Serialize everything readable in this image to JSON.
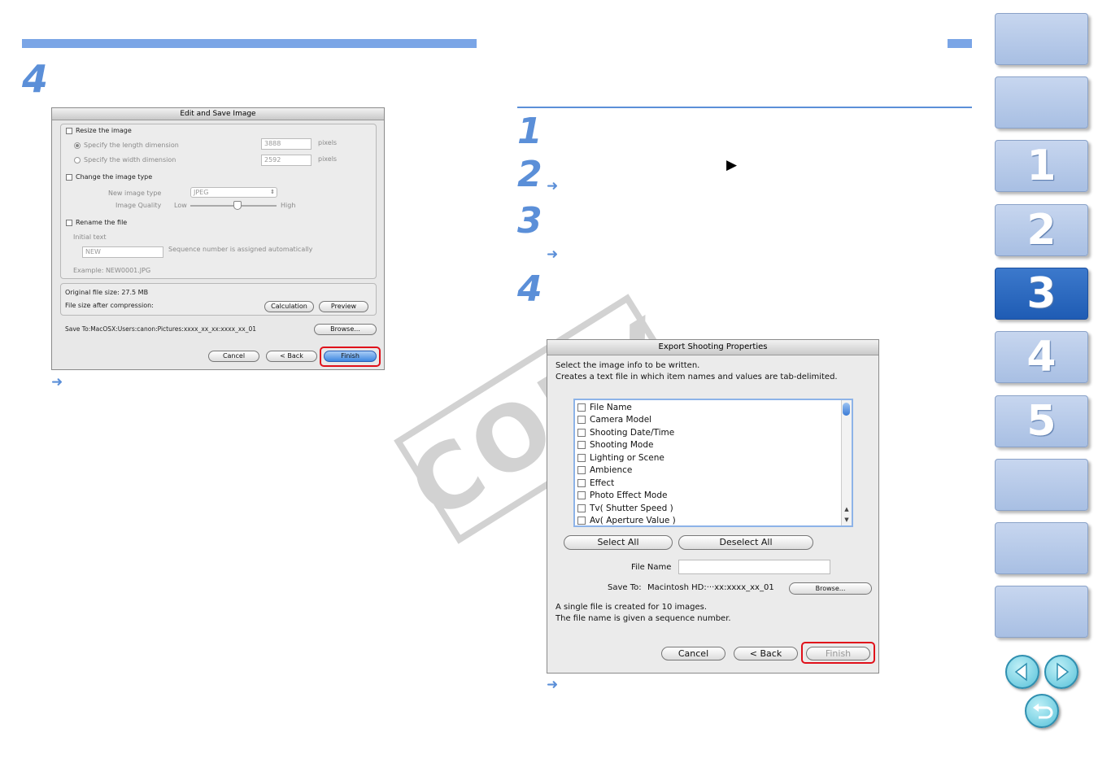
{
  "page": {
    "left_step": "4",
    "right_steps": [
      "1",
      "2",
      "3",
      "4"
    ],
    "arrow_symbol": "➜",
    "play_symbol": "▶"
  },
  "edit_dialog": {
    "title": "Edit and Save Image",
    "resize_label": "Resize the image",
    "length_option": "Specify the length dimension",
    "width_option": "Specify the width dimension",
    "length_value": "3888",
    "width_value": "2592",
    "pixels_unit": "pixels",
    "change_type_label": "Change the image type",
    "new_type_label": "New image type",
    "new_type_value": "JPEG",
    "quality_label": "Image Quality",
    "quality_low": "Low",
    "quality_high": "High",
    "quality_level": 0.55,
    "rename_label": "Rename the file",
    "initial_text_label": "Initial text",
    "initial_text_value": "NEW",
    "sequence_note": "Sequence number is assigned automatically",
    "example_text": "Example:  NEW0001.JPG",
    "original_size_label": "Original file size:",
    "original_size_value": "27.5 MB",
    "compressed_size_label": "File size after compression:",
    "calculation_button": "Calculation",
    "preview_button": "Preview",
    "save_to": "Save To:MacOSX:Users:canon:Pictures:xxxx_xx_xx:xxxx_xx_01",
    "browse_button": "Browse...",
    "cancel_button": "Cancel",
    "back_button": "< Back",
    "finish_button": "Finish"
  },
  "export_dialog": {
    "title": "Export Shooting Properties",
    "instruction_1": "Select the image info to be written.",
    "instruction_2": "Creates a text file in which item names and values are tab-delimited.",
    "items": [
      "File Name",
      "Camera Model",
      "Shooting Date/Time",
      "Shooting Mode",
      "Lighting or Scene",
      "Ambience",
      "Effect",
      "Photo Effect Mode",
      "Tv( Shutter Speed )",
      "Av( Aperture Value )"
    ],
    "select_all_button": "Select All",
    "deselect_all_button": "Deselect All",
    "file_name_label": "File Name",
    "save_to_label": "Save To:",
    "save_to_value": "Macintosh HD:···xx:xxxx_xx_01",
    "browse_button": "Browse...",
    "note_1": "A single file is created for 10 images.",
    "note_2": "The file name is given a sequence number.",
    "cancel_button": "Cancel",
    "back_button": "< Back",
    "finish_button": "Finish"
  },
  "watermark": "COPY",
  "side_nav": {
    "tabs": [
      "",
      "",
      "1",
      "2",
      "3",
      "4",
      "5",
      "",
      "",
      ""
    ],
    "active_tab": "3"
  }
}
